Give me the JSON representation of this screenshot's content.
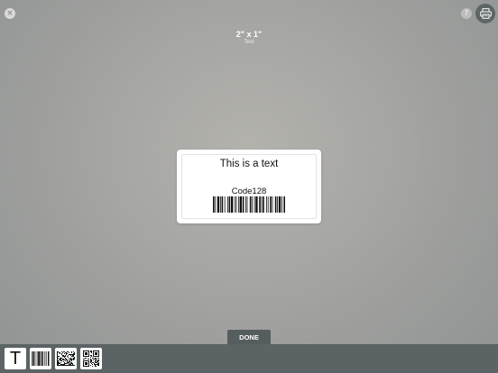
{
  "header": {
    "close_icon": "×",
    "help_icon": "?",
    "label_size": "2\" x 1\"",
    "label_name": "Test"
  },
  "label": {
    "text": "This is a text",
    "barcode_caption": "Code128"
  },
  "done_button": "DONE",
  "toolbar": {
    "text_tool_glyph": "T"
  }
}
